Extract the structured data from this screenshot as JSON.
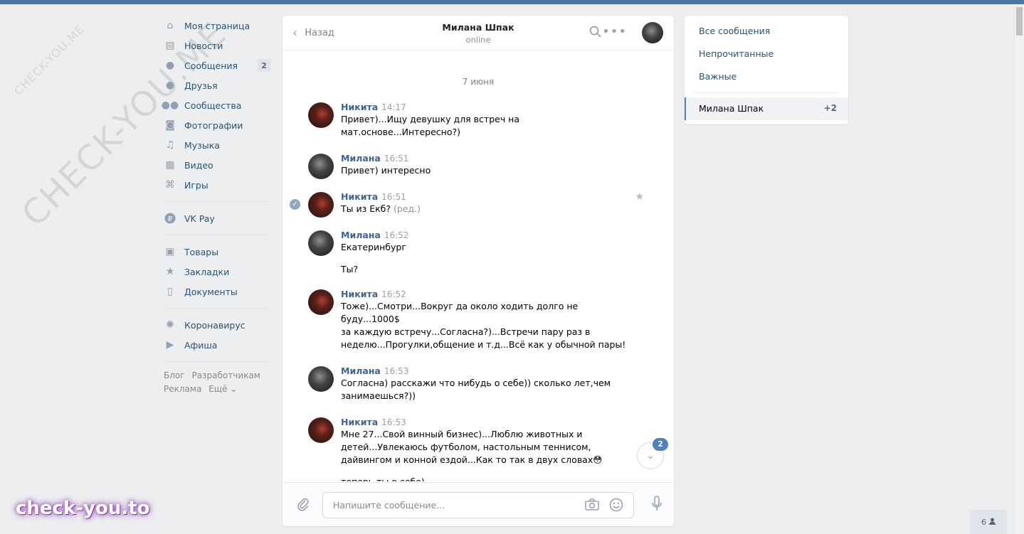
{
  "nav": {
    "items": [
      {
        "label": "Моя страница",
        "icon": "home-icon",
        "glyph": "⌂"
      },
      {
        "label": "Новости",
        "icon": "news-icon",
        "glyph": "▤"
      },
      {
        "label": "Сообщения",
        "icon": "messages-icon",
        "glyph": "●",
        "badge": "2"
      },
      {
        "label": "Друзья",
        "icon": "friends-icon",
        "glyph": "●"
      },
      {
        "label": "Сообщества",
        "icon": "communities-icon",
        "glyph": "●●"
      },
      {
        "label": "Фотографии",
        "icon": "camera-icon",
        "glyph": "◙"
      },
      {
        "label": "Музыка",
        "icon": "music-icon",
        "glyph": "♫"
      },
      {
        "label": "Видео",
        "icon": "video-icon",
        "glyph": "▦"
      },
      {
        "label": "Игры",
        "icon": "games-icon",
        "glyph": "⌘"
      }
    ],
    "pay": {
      "label": "VK Pay",
      "icon": "vkpay-icon",
      "glyph": "₽"
    },
    "extra": [
      {
        "label": "Товары",
        "icon": "shopping-bag-icon",
        "glyph": "▣"
      },
      {
        "label": "Закладки",
        "icon": "star-icon",
        "glyph": "★"
      },
      {
        "label": "Документы",
        "icon": "document-icon",
        "glyph": "▯"
      }
    ],
    "special": [
      {
        "label": "Коронавирус",
        "icon": "virus-icon",
        "glyph": "✺"
      },
      {
        "label": "Афиша",
        "icon": "play-icon",
        "glyph": "▶"
      }
    ],
    "footer": {
      "blog": "Блог",
      "dev": "Разработчикам",
      "ads": "Реклама",
      "more": "Ещё ⌄"
    }
  },
  "chat": {
    "back_label": "Назад",
    "peer_name": "Милана Шпак",
    "peer_status": "online",
    "date": "7 июня",
    "messages": [
      {
        "author": "Никита",
        "time": "14:17",
        "text": "Привет)...Ищу девушку для встреч на\nмат.основе...Интересно?)",
        "av": "n"
      },
      {
        "author": "Милана",
        "time": "16:51",
        "text": "Привет) интересно",
        "av": "m"
      },
      {
        "author": "Никита",
        "time": "16:51",
        "text": "Ты из Екб?",
        "edited": "(ред.)",
        "av": "n",
        "selected": true
      },
      {
        "author": "Милана",
        "time": "16:52",
        "text": "Екатеринбург",
        "text2": "Ты?",
        "av": "m"
      },
      {
        "author": "Никита",
        "time": "16:52",
        "text": "Тоже)...Смотри...Вокруг да около ходить долго не буду...1000$\nза каждую встречу...Согласна?)...Встречи пару раз в\nнеделю...Прогулки,общение и т.д...Всё как у обычной пары!",
        "av": "n"
      },
      {
        "author": "Милана",
        "time": "16:53",
        "text": "Согласна) расскажи что нибудь о себе)) сколько лет,чем\nзанимаешься?))",
        "av": "m"
      },
      {
        "author": "Никита",
        "time": "16:53",
        "text": "Мне 27...Свой винный бизнес)...Люблю животных и\nдетей...Увлекаюсь футболом, настольным теннисом,\nдайвингом и конной ездой...Как то так в двух словах😳",
        "text2": "теперь ты о себе)",
        "av": "n"
      }
    ],
    "unread_badge": "2",
    "input_placeholder": "Напишите сообщение..."
  },
  "filters": {
    "all": "Все сообщения",
    "unread": "Непрочитанные",
    "important": "Важные",
    "active_chat": "Милана Шпак",
    "active_count": "+2"
  },
  "online_count": "6",
  "watermark": {
    "small": "CHECK-YOU.ME",
    "big": "CHECK-YOU.ME",
    "logo": "check-you.to"
  },
  "colors": {
    "accent": "#4a76a8",
    "link": "#285473",
    "name": "#42648b"
  }
}
